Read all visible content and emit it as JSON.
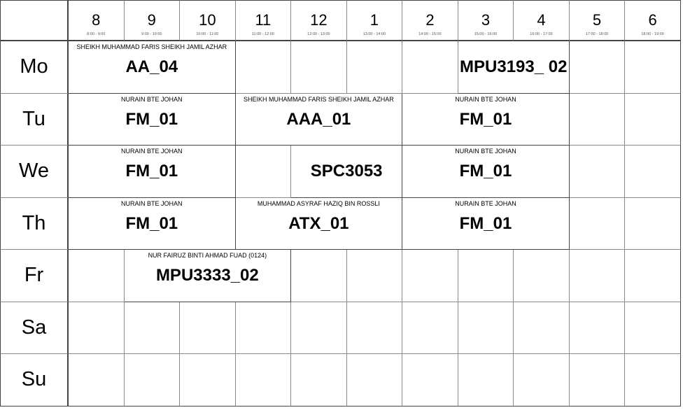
{
  "hours": [
    {
      "label": "8",
      "range": "8:00 - 9:00"
    },
    {
      "label": "9",
      "range": "9:00 - 10:00"
    },
    {
      "label": "10",
      "range": "10:00 - 11:00"
    },
    {
      "label": "11",
      "range": "11:00 - 12:00"
    },
    {
      "label": "12",
      "range": "12:00 - 13:00"
    },
    {
      "label": "1",
      "range": "13:00 - 14:00"
    },
    {
      "label": "2",
      "range": "14:00 - 15:00"
    },
    {
      "label": "3",
      "range": "15:00 - 16:00"
    },
    {
      "label": "4",
      "range": "16:00 - 17:00"
    },
    {
      "label": "5",
      "range": "17:00 - 18:00"
    },
    {
      "label": "6",
      "range": "18:00 - 19:00"
    }
  ],
  "days": [
    "Mo",
    "Tu",
    "We",
    "Th",
    "Fr",
    "Sa",
    "Su"
  ],
  "events": [
    {
      "day": 0,
      "start": 0,
      "span": 3,
      "lecturer": "SHEIKH MUHAMMAD FARIS SHEIKH JAMIL AZHAR",
      "code": "AA_04"
    },
    {
      "day": 0,
      "start": 7,
      "span": 2,
      "lecturer": "",
      "code": "MPU3193_ 02"
    },
    {
      "day": 1,
      "start": 0,
      "span": 3,
      "lecturer": "NURAIN BTE JOHAN",
      "code": "FM_01"
    },
    {
      "day": 1,
      "start": 3,
      "span": 3,
      "lecturer": "SHEIKH MUHAMMAD FARIS SHEIKH JAMIL AZHAR",
      "code": "AAA_01"
    },
    {
      "day": 1,
      "start": 6,
      "span": 3,
      "lecturer": "NURAIN BTE JOHAN",
      "code": "FM_01"
    },
    {
      "day": 2,
      "start": 0,
      "span": 3,
      "lecturer": "NURAIN BTE JOHAN",
      "code": "FM_01"
    },
    {
      "day": 2,
      "start": 4,
      "span": 2,
      "lecturer": "",
      "code": "SPC3053"
    },
    {
      "day": 2,
      "start": 6,
      "span": 3,
      "lecturer": "NURAIN BTE JOHAN",
      "code": "FM_01"
    },
    {
      "day": 3,
      "start": 0,
      "span": 3,
      "lecturer": "NURAIN BTE JOHAN",
      "code": "FM_01"
    },
    {
      "day": 3,
      "start": 3,
      "span": 3,
      "lecturer": "MUHAMMAD ASYRAF HAZIQ BIN ROSSLI",
      "code": "ATX_01"
    },
    {
      "day": 3,
      "start": 6,
      "span": 3,
      "lecturer": "NURAIN BTE JOHAN",
      "code": "FM_01"
    },
    {
      "day": 4,
      "start": 1,
      "span": 3,
      "lecturer": "NUR FAIRUZ BINTI AHMAD FUAD (0124)",
      "code": "MPU3333_02"
    }
  ]
}
